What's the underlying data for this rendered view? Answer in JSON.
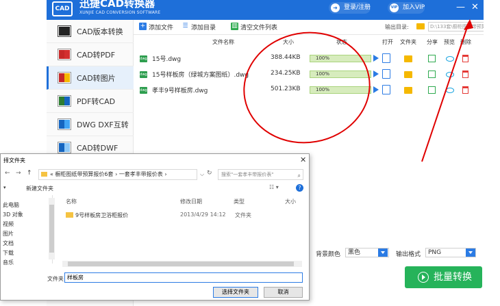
{
  "app": {
    "title_cn": "迅捷CAD转换器",
    "title_en": "XUNJIE CAD CONVERSION SOFTWARE",
    "logo": "CAD",
    "login_label": "登录/注册",
    "vip_label": "加入VIP",
    "vip_icon_text": "VIP",
    "minimize_glyph": "—",
    "close_glyph": "✕"
  },
  "sidebar": {
    "items": [
      {
        "label": "CAD版本转换"
      },
      {
        "label": "CAD转PDF"
      },
      {
        "label": "CAD转图片"
      },
      {
        "label": "PDF转CAD"
      },
      {
        "label": "DWG DXF互转"
      },
      {
        "label": "CAD转DWF"
      }
    ],
    "active_index": 2
  },
  "toolbar": {
    "add_file": "添加文件",
    "add_dir": "添加目录",
    "clear_list": "清空文件列表",
    "output_dir_label": "输出目录:",
    "output_dir_value": "D:\\133套\\橱柜图纸带预算报价6套",
    "browse": "浏览"
  },
  "table": {
    "headers": {
      "name": "文件名称",
      "size": "大小",
      "status": "状态",
      "open": "打开",
      "folder": "文件夹",
      "share": "分享",
      "preview": "预览",
      "delete": "删除"
    },
    "rows": [
      {
        "badge": "dwg",
        "name": "15号.dwg",
        "size": "388.44KB",
        "progress": 100,
        "progress_text": "100%"
      },
      {
        "badge": "dwg",
        "name": "15号样板房（绿城方案图纸）.dwg",
        "size": "234.25KB",
        "progress": 100,
        "progress_text": "100%"
      },
      {
        "badge": "dwg",
        "name": "孝丰9号样板房.dwg",
        "size": "501.23KB",
        "progress": 100,
        "progress_text": "100%"
      }
    ]
  },
  "options": {
    "bg_label": "背景颜色",
    "bg_value": "黑色",
    "format_label": "输出格式",
    "format_value": "PNG"
  },
  "convert": {
    "label": "批量转换"
  },
  "dialog": {
    "title": "择文件夹",
    "close_glyph": "✕",
    "back_glyph": "←",
    "forward_glyph": "→",
    "up_glyph": "↑",
    "breadcrumb": "« 橱柜图纸带预算报价6套 › 一套孝丰带报价表 ›",
    "refresh_glyph": "↻",
    "search_placeholder": "搜索\"一套孝丰带报价表\"",
    "new_folder": "新建文件夹",
    "view_glyph": "☷ ▾",
    "help_glyph": "?",
    "columns": {
      "name": "名称",
      "date": "修改日期",
      "type": "类型",
      "size": "大小"
    },
    "tree": [
      "此电脑",
      "3D 对象",
      "视频",
      "图片",
      "文档",
      "下载",
      "音乐"
    ],
    "files": [
      {
        "name": "9号样板房卫浴柜报价",
        "date": "2013/4/29 14:12",
        "type": "文件夹"
      }
    ],
    "folder_label": "文件夹:",
    "folder_value": "样板房",
    "select_btn": "选择文件夹",
    "cancel_btn": "取消"
  },
  "colors": {
    "brand_blue": "#1e6fd9",
    "convert_green": "#26b35a",
    "annotation_red": "#e00000"
  }
}
